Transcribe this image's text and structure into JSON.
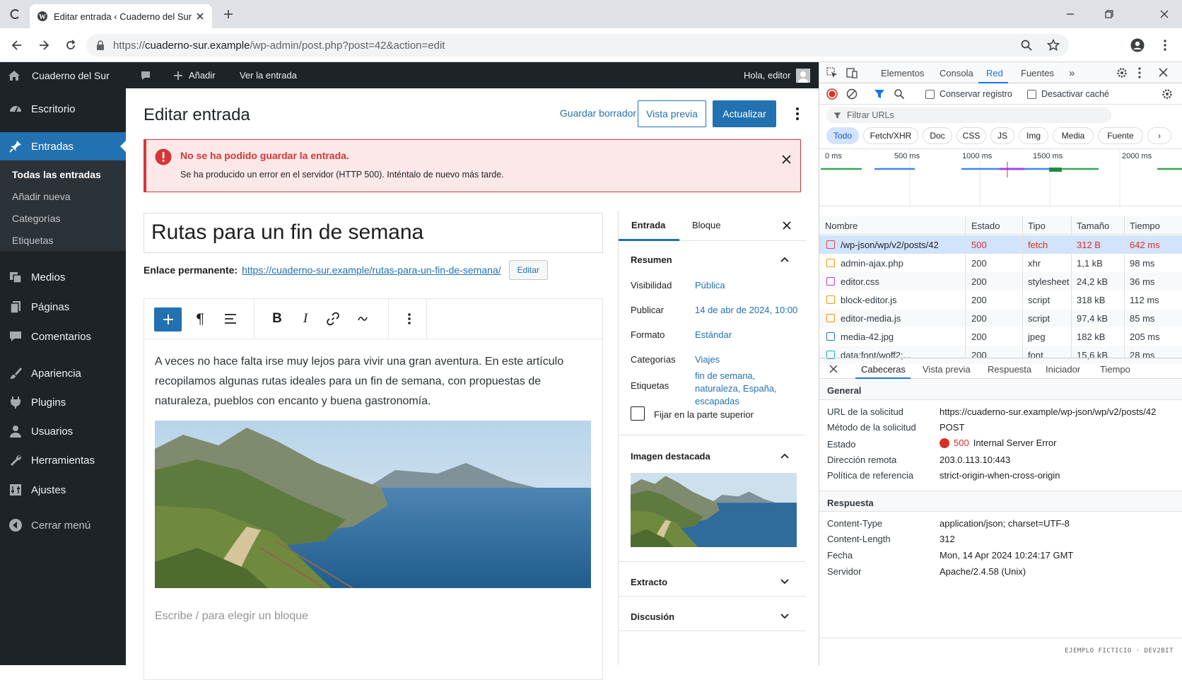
{
  "browser": {
    "tab_title": "Editar entrada ‹ Cuaderno del Sur",
    "url_host": "cuaderno-sur.example",
    "url_path": "/wp-admin/post.php?post=42&action=edit",
    "url_prefix": "https://"
  },
  "wp_bar": {
    "site_name": "Cuaderno del Sur",
    "add_label": "Añadir",
    "view_label": "Ver la entrada",
    "greeting": "Hola, editor"
  },
  "sidebar": {
    "items": [
      {
        "label": "Escritorio",
        "icon": "dashboard-icon"
      },
      {
        "label": "Entradas",
        "icon": "pin-icon"
      },
      {
        "label": "Medios",
        "icon": "media-icon"
      },
      {
        "label": "Páginas",
        "icon": "pages-icon"
      },
      {
        "label": "Comentarios",
        "icon": "comments-icon"
      },
      {
        "label": "Apariencia",
        "icon": "brush-icon"
      },
      {
        "label": "Plugins",
        "icon": "plugin-icon"
      },
      {
        "label": "Usuarios",
        "icon": "user-icon"
      },
      {
        "label": "Herramientas",
        "icon": "wrench-icon"
      },
      {
        "label": "Ajustes",
        "icon": "settings-icon"
      },
      {
        "label": "Cerrar menú",
        "icon": "collapse-icon"
      }
    ],
    "submenu": [
      "Todas las entradas",
      "Añadir nueva",
      "Categorías",
      "Etiquetas"
    ]
  },
  "editor": {
    "heading": "Editar entrada",
    "save_draft": "Guardar borrador",
    "preview": "Vista previa",
    "update": "Actualizar",
    "notice_title": "No se ha podido guardar la entrada.",
    "notice_text": "Se ha producido un error en el servidor (HTTP 500). Inténtalo de nuevo más tarde.",
    "post_title": "Rutas para un fin de semana",
    "permalink_label": "Enlace permanente:",
    "permalink_url": "https://cuaderno-sur.example/rutas-para-un-fin-de-semana/",
    "permalink_edit": "Editar",
    "paragraph": "A veces no hace falta irse muy lejos para vivir una gran aventura. En este artículo recopilamos algunas rutas ideales para un fin de semana, con propuestas de naturaleza, pueblos con encanto y buena gastronomía.",
    "placeholder": "Escribe / para elegir un bloque"
  },
  "settings": {
    "tab_post": "Entrada",
    "tab_block": "Bloque",
    "summary": "Resumen",
    "rows": [
      {
        "label": "Visibilidad",
        "value": "Pública"
      },
      {
        "label": "Publicar",
        "value": "14 de abr de 2024, 10:00"
      },
      {
        "label": "Formato",
        "value": "Estándar"
      },
      {
        "label": "Categorías",
        "value": "Viajes"
      },
      {
        "label": "Etiquetas",
        "value": "fin de semana, naturaleza, España, escapadas"
      }
    ],
    "sticky": "Fijar en la parte superior",
    "featured": "Imagen destacada",
    "excerpt": "Extracto",
    "discussion": "Discusión"
  },
  "devtools": {
    "tabs": [
      "Elementos",
      "Consola",
      "Red",
      "Fuentes"
    ],
    "active_tab": "Red",
    "preserve_log": "Conservar registro",
    "disable_cache": "Desactivar caché",
    "filter_placeholder": "Filtrar URLs",
    "chips": [
      "Todo",
      "Fetch/XHR",
      "Doc",
      "CSS",
      "JS",
      "Img",
      "Media",
      "Fuente"
    ],
    "timeline_ticks": [
      "0 ms",
      "500 ms",
      "1000 ms",
      "1500 ms",
      "2000 ms"
    ],
    "columns": [
      "Nombre",
      "Estado",
      "Tipo",
      "Tamaño",
      "Tiempo"
    ],
    "requests": [
      {
        "name": "/wp-json/wp/v2/posts/42",
        "status": "500",
        "type": "fetch",
        "size": "312 B",
        "time": "642 ms",
        "error": true,
        "color": "#e8453c"
      },
      {
        "name": "admin-ajax.php",
        "status": "200",
        "type": "xhr",
        "size": "1,1 kB",
        "time": "98 ms",
        "color": "#f29900"
      },
      {
        "name": "editor.css",
        "status": "200",
        "type": "stylesheet",
        "size": "24,2 kB",
        "time": "36 ms",
        "color": "#a142f4"
      },
      {
        "name": "block-editor.js",
        "status": "200",
        "type": "script",
        "size": "318 kB",
        "time": "112 ms",
        "color": "#f29900"
      },
      {
        "name": "editor-media.js",
        "status": "200",
        "type": "script",
        "size": "97,4 kB",
        "time": "85 ms",
        "color": "#f29900"
      },
      {
        "name": "media-42.jpg",
        "status": "200",
        "type": "jpeg",
        "size": "182 kB",
        "time": "205 ms",
        "color": "#1a73e8"
      },
      {
        "name": "data:font/woff2;...",
        "status": "200",
        "type": "font",
        "size": "15,6 kB",
        "time": "28 ms",
        "color": "#12b5cb"
      }
    ],
    "detail_tabs": [
      "Cabeceras",
      "Vista previa",
      "Respuesta",
      "Iniciador",
      "Tiempo"
    ],
    "general_title": "General",
    "general": [
      {
        "k": "URL de la solicitud",
        "v": "https://cuaderno-sur.example/wp-json/wp/v2/posts/42"
      },
      {
        "k": "Método de la solicitud",
        "v": "POST"
      },
      {
        "k": "Estado",
        "v": "Internal Server Error",
        "code": "500"
      },
      {
        "k": "Dirección remota",
        "v": "203.0.113.10:443"
      },
      {
        "k": "Política de referencia",
        "v": "strict-origin-when-cross-origin"
      }
    ],
    "response_title": "Respuesta",
    "response": [
      {
        "k": "Content-Type",
        "v": "application/json; charset=UTF-8"
      },
      {
        "k": "Content-Length",
        "v": "312"
      },
      {
        "k": "Fecha",
        "v": "Mon, 14 Apr 2024 10:24:17 GMT"
      },
      {
        "k": "Servidor",
        "v": "Apache/2.4.58 (Unix)"
      }
    ],
    "footer": "EJEMPLO FICTICIO · DEV2BIT"
  },
  "colors": {
    "wp_blue": "#2271b1",
    "wp_dark": "#1d2327",
    "error": "#d63638"
  }
}
